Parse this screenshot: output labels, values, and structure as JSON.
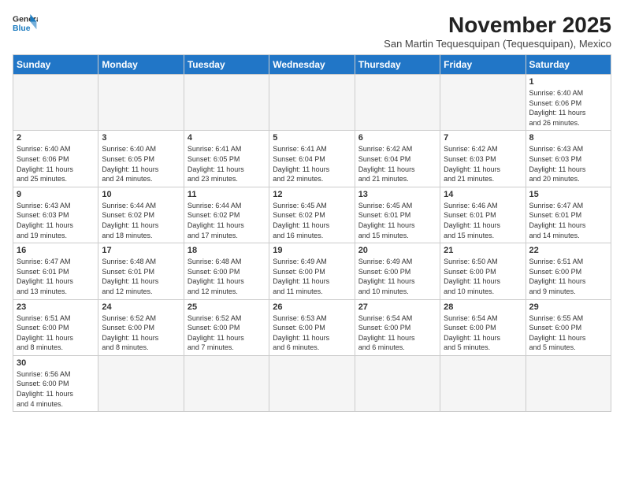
{
  "header": {
    "logo_line1": "General",
    "logo_line2": "Blue",
    "month": "November 2025",
    "location": "San Martin Tequesquipan (Tequesquipan), Mexico"
  },
  "days_of_week": [
    "Sunday",
    "Monday",
    "Tuesday",
    "Wednesday",
    "Thursday",
    "Friday",
    "Saturday"
  ],
  "weeks": [
    [
      {
        "day": "",
        "info": ""
      },
      {
        "day": "",
        "info": ""
      },
      {
        "day": "",
        "info": ""
      },
      {
        "day": "",
        "info": ""
      },
      {
        "day": "",
        "info": ""
      },
      {
        "day": "",
        "info": ""
      },
      {
        "day": "1",
        "info": "Sunrise: 6:40 AM\nSunset: 6:06 PM\nDaylight: 11 hours\nand 26 minutes."
      }
    ],
    [
      {
        "day": "2",
        "info": "Sunrise: 6:40 AM\nSunset: 6:06 PM\nDaylight: 11 hours\nand 25 minutes."
      },
      {
        "day": "3",
        "info": "Sunrise: 6:40 AM\nSunset: 6:05 PM\nDaylight: 11 hours\nand 24 minutes."
      },
      {
        "day": "4",
        "info": "Sunrise: 6:41 AM\nSunset: 6:05 PM\nDaylight: 11 hours\nand 23 minutes."
      },
      {
        "day": "5",
        "info": "Sunrise: 6:41 AM\nSunset: 6:04 PM\nDaylight: 11 hours\nand 22 minutes."
      },
      {
        "day": "6",
        "info": "Sunrise: 6:42 AM\nSunset: 6:04 PM\nDaylight: 11 hours\nand 21 minutes."
      },
      {
        "day": "7",
        "info": "Sunrise: 6:42 AM\nSunset: 6:03 PM\nDaylight: 11 hours\nand 21 minutes."
      },
      {
        "day": "8",
        "info": "Sunrise: 6:43 AM\nSunset: 6:03 PM\nDaylight: 11 hours\nand 20 minutes."
      }
    ],
    [
      {
        "day": "9",
        "info": "Sunrise: 6:43 AM\nSunset: 6:03 PM\nDaylight: 11 hours\nand 19 minutes."
      },
      {
        "day": "10",
        "info": "Sunrise: 6:44 AM\nSunset: 6:02 PM\nDaylight: 11 hours\nand 18 minutes."
      },
      {
        "day": "11",
        "info": "Sunrise: 6:44 AM\nSunset: 6:02 PM\nDaylight: 11 hours\nand 17 minutes."
      },
      {
        "day": "12",
        "info": "Sunrise: 6:45 AM\nSunset: 6:02 PM\nDaylight: 11 hours\nand 16 minutes."
      },
      {
        "day": "13",
        "info": "Sunrise: 6:45 AM\nSunset: 6:01 PM\nDaylight: 11 hours\nand 15 minutes."
      },
      {
        "day": "14",
        "info": "Sunrise: 6:46 AM\nSunset: 6:01 PM\nDaylight: 11 hours\nand 15 minutes."
      },
      {
        "day": "15",
        "info": "Sunrise: 6:47 AM\nSunset: 6:01 PM\nDaylight: 11 hours\nand 14 minutes."
      }
    ],
    [
      {
        "day": "16",
        "info": "Sunrise: 6:47 AM\nSunset: 6:01 PM\nDaylight: 11 hours\nand 13 minutes."
      },
      {
        "day": "17",
        "info": "Sunrise: 6:48 AM\nSunset: 6:01 PM\nDaylight: 11 hours\nand 12 minutes."
      },
      {
        "day": "18",
        "info": "Sunrise: 6:48 AM\nSunset: 6:00 PM\nDaylight: 11 hours\nand 12 minutes."
      },
      {
        "day": "19",
        "info": "Sunrise: 6:49 AM\nSunset: 6:00 PM\nDaylight: 11 hours\nand 11 minutes."
      },
      {
        "day": "20",
        "info": "Sunrise: 6:49 AM\nSunset: 6:00 PM\nDaylight: 11 hours\nand 10 minutes."
      },
      {
        "day": "21",
        "info": "Sunrise: 6:50 AM\nSunset: 6:00 PM\nDaylight: 11 hours\nand 10 minutes."
      },
      {
        "day": "22",
        "info": "Sunrise: 6:51 AM\nSunset: 6:00 PM\nDaylight: 11 hours\nand 9 minutes."
      }
    ],
    [
      {
        "day": "23",
        "info": "Sunrise: 6:51 AM\nSunset: 6:00 PM\nDaylight: 11 hours\nand 8 minutes."
      },
      {
        "day": "24",
        "info": "Sunrise: 6:52 AM\nSunset: 6:00 PM\nDaylight: 11 hours\nand 8 minutes."
      },
      {
        "day": "25",
        "info": "Sunrise: 6:52 AM\nSunset: 6:00 PM\nDaylight: 11 hours\nand 7 minutes."
      },
      {
        "day": "26",
        "info": "Sunrise: 6:53 AM\nSunset: 6:00 PM\nDaylight: 11 hours\nand 6 minutes."
      },
      {
        "day": "27",
        "info": "Sunrise: 6:54 AM\nSunset: 6:00 PM\nDaylight: 11 hours\nand 6 minutes."
      },
      {
        "day": "28",
        "info": "Sunrise: 6:54 AM\nSunset: 6:00 PM\nDaylight: 11 hours\nand 5 minutes."
      },
      {
        "day": "29",
        "info": "Sunrise: 6:55 AM\nSunset: 6:00 PM\nDaylight: 11 hours\nand 5 minutes."
      }
    ],
    [
      {
        "day": "30",
        "info": "Sunrise: 6:56 AM\nSunset: 6:00 PM\nDaylight: 11 hours\nand 4 minutes."
      },
      {
        "day": "",
        "info": ""
      },
      {
        "day": "",
        "info": ""
      },
      {
        "day": "",
        "info": ""
      },
      {
        "day": "",
        "info": ""
      },
      {
        "day": "",
        "info": ""
      },
      {
        "day": "",
        "info": ""
      }
    ]
  ]
}
